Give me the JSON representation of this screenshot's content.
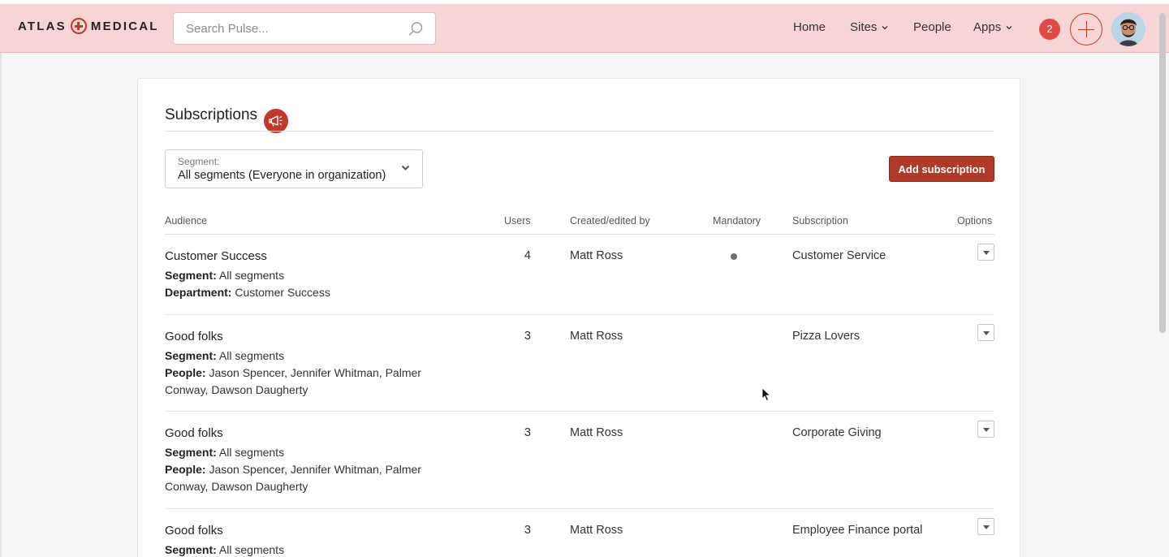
{
  "brand": {
    "left": "ATLAS",
    "right": "MEDICAL"
  },
  "search": {
    "placeholder": "Search Pulse..."
  },
  "nav": {
    "home": "Home",
    "sites": "Sites",
    "people": "People",
    "apps": "Apps"
  },
  "notifications": {
    "count": "2"
  },
  "colors": {
    "header_bg": "#f7d5d5",
    "accent": "#c0392b",
    "button": "#b03a28",
    "badge": "#e14b47"
  },
  "page": {
    "title": "Subscriptions"
  },
  "segment": {
    "label": "Segment:",
    "value": "All segments (Everyone in organization)"
  },
  "add_button": "Add subscription",
  "table": {
    "headers": {
      "audience": "Audience",
      "users": "Users",
      "created": "Created/edited by",
      "mandatory": "Mandatory",
      "subscription": "Subscription",
      "options": "Options"
    },
    "rows": [
      {
        "audience": "Customer Success",
        "meta": [
          {
            "key": "Segment:",
            "value": "All segments"
          },
          {
            "key": "Department:",
            "value": "Customer Success"
          }
        ],
        "users": "4",
        "created_by": "Matt Ross",
        "mandatory": true,
        "subscription": "Customer Service"
      },
      {
        "audience": "Good folks",
        "meta": [
          {
            "key": "Segment:",
            "value": "All segments"
          },
          {
            "key": "People:",
            "value": "Jason Spencer, Jennifer Whitman, Palmer",
            "cont": "Conway, Dawson Daugherty"
          }
        ],
        "users": "3",
        "created_by": "Matt Ross",
        "mandatory": false,
        "subscription": "Pizza Lovers"
      },
      {
        "audience": "Good folks",
        "meta": [
          {
            "key": "Segment:",
            "value": "All segments"
          },
          {
            "key": "People:",
            "value": "Jason Spencer, Jennifer Whitman, Palmer",
            "cont": "Conway, Dawson Daugherty"
          }
        ],
        "users": "3",
        "created_by": "Matt Ross",
        "mandatory": false,
        "subscription": "Corporate Giving"
      },
      {
        "audience": "Good folks",
        "meta": [
          {
            "key": "Segment:",
            "value": "All segments"
          }
        ],
        "users": "3",
        "created_by": "Matt Ross",
        "mandatory": false,
        "subscription": "Employee Finance portal"
      }
    ]
  }
}
